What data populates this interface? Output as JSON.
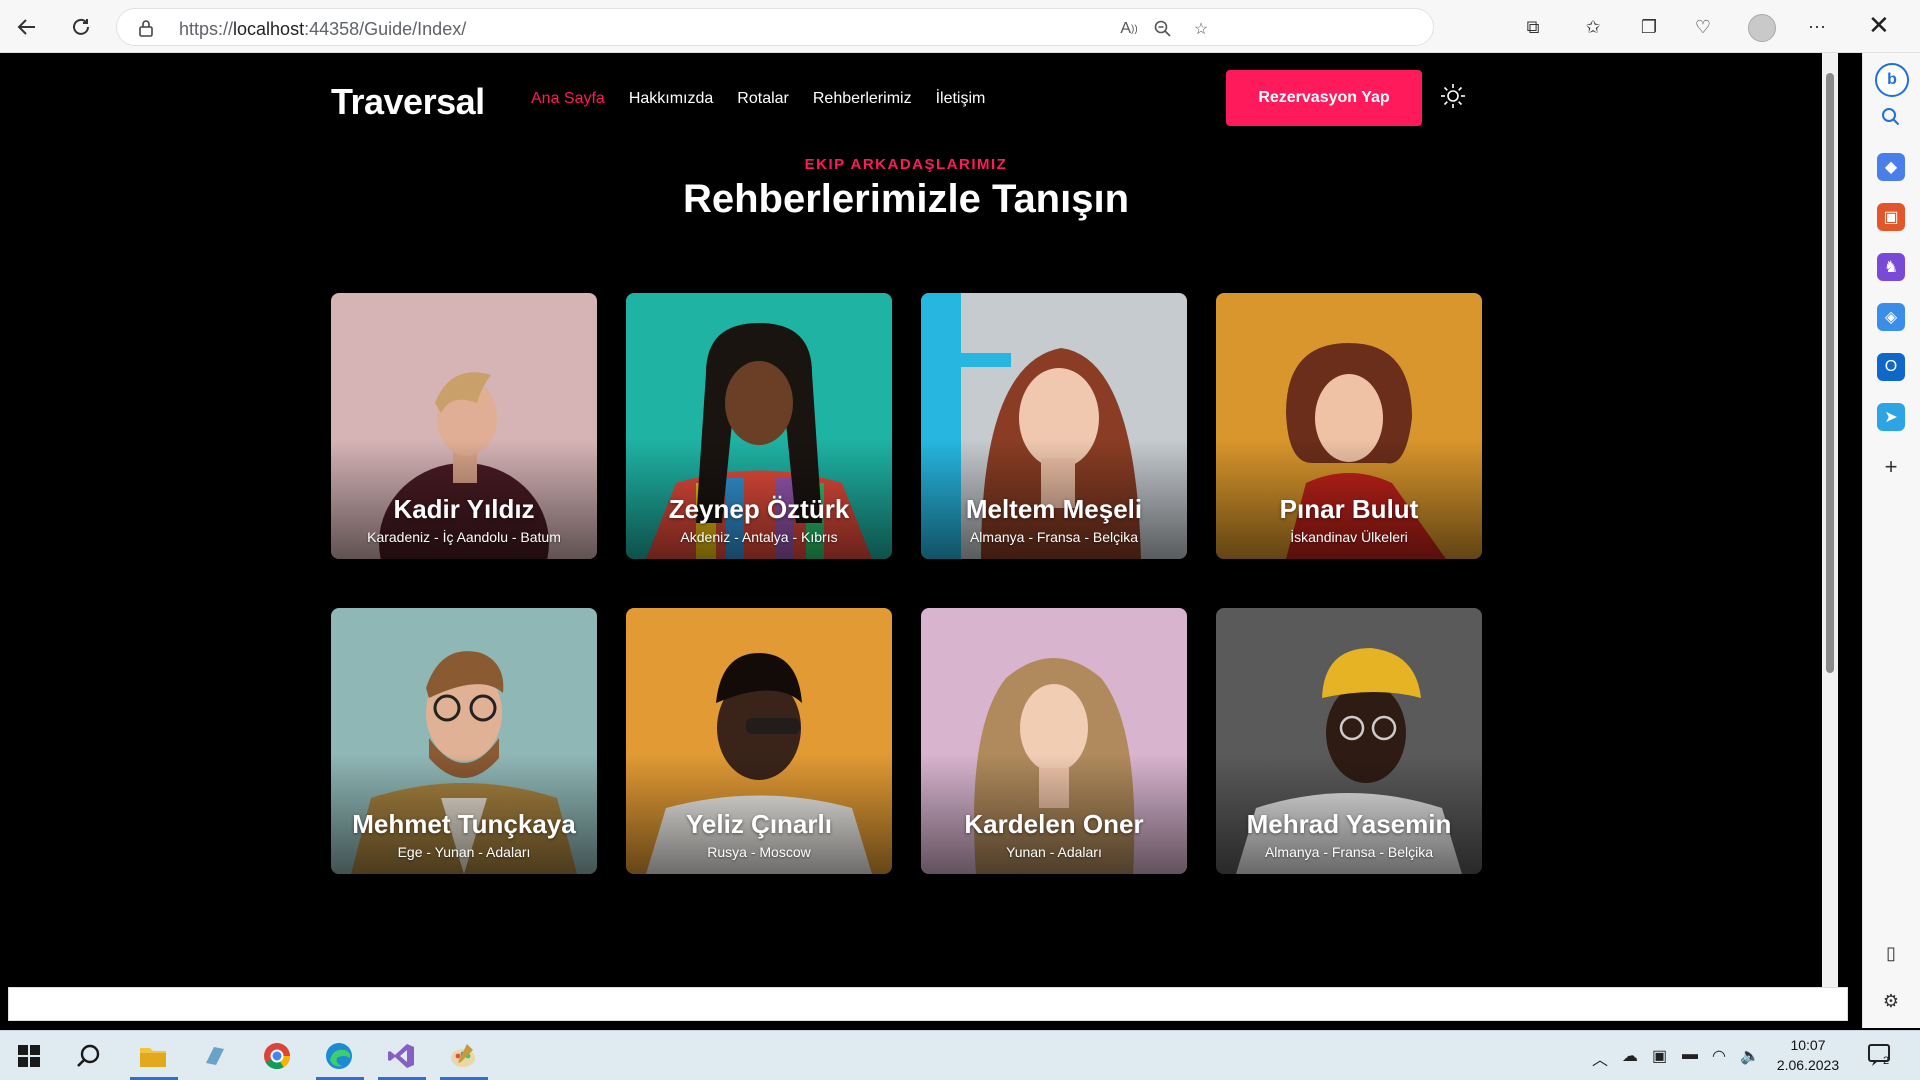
{
  "browser": {
    "url_prefix": "https://",
    "url_host": "localhost",
    "url_rest": ":44358/Guide/Index/"
  },
  "site": {
    "logo": "Traversal",
    "menu": [
      "Ana Sayfa",
      "Hakkımızda",
      "Rotalar",
      "Rehberlerimiz",
      "İletişim"
    ],
    "active_menu": "Ana Sayfa",
    "cta": "Rezervasyon Yap",
    "eyebrow": "EKIP ARKADAŞLARIMIZ",
    "heading": "Rehberlerimizle Tanışın"
  },
  "guides": [
    {
      "name": "Kadir Yıldız",
      "route": "Karadeniz - İç Aandolu - Batum"
    },
    {
      "name": "Zeynep Öztürk",
      "route": "Akdeniz - Antalya - Kıbrıs"
    },
    {
      "name": "Meltem Meşeli",
      "route": "Almanya - Fransa - Belçika"
    },
    {
      "name": "Pınar Bulut",
      "route": "İskandinav Ülkeleri"
    },
    {
      "name": "Mehmet Tunçkaya",
      "route": "Ege - Yunan - Adaları"
    },
    {
      "name": "Yeliz Çınarlı",
      "route": "Rusya - Moscow"
    },
    {
      "name": "Kardelen Oner",
      "route": "Yunan - Adaları"
    },
    {
      "name": "Mehrad Yasemin",
      "route": "Almanya - Fransa - Belçika"
    }
  ],
  "taskbar": {
    "time": "10:07",
    "date": "2.06.2023",
    "notifications": "2"
  },
  "colors": {
    "accent": "#ff1a5b",
    "page_bg": "#000000"
  }
}
